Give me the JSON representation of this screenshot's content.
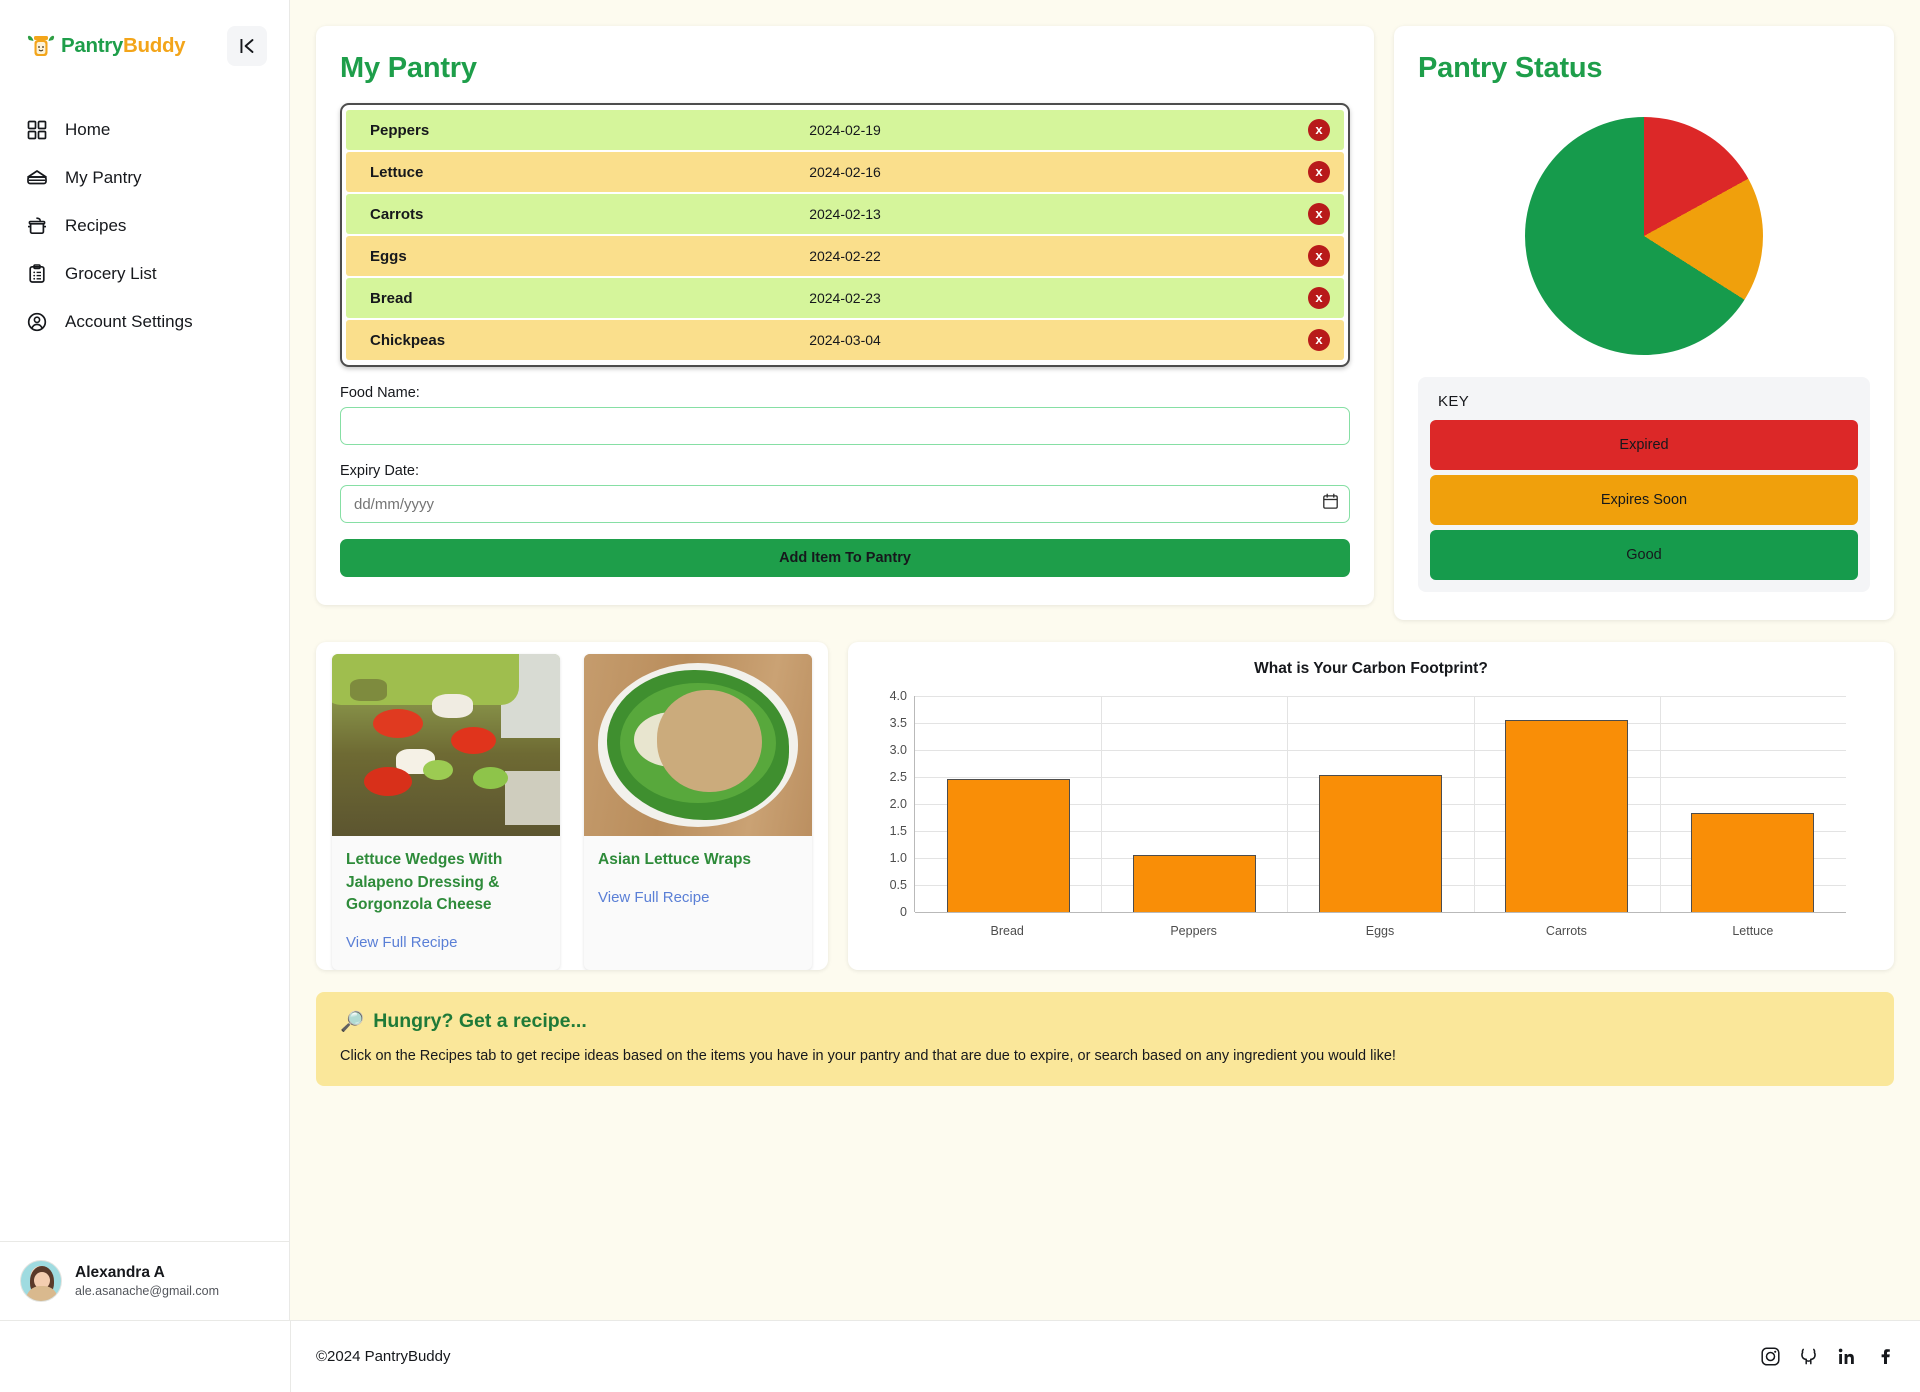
{
  "brand": {
    "name_part1": "Pantry",
    "name_part2": "Buddy",
    "collapse_icon": "collapse-sidebar-icon",
    "collapse_glyph": "I‹"
  },
  "sidebar": {
    "items": [
      {
        "label": "Home",
        "icon": "grid-icon"
      },
      {
        "label": "My Pantry",
        "icon": "pantry-icon"
      },
      {
        "label": "Recipes",
        "icon": "pot-icon"
      },
      {
        "label": "Grocery List",
        "icon": "clipboard-icon"
      },
      {
        "label": "Account Settings",
        "icon": "user-circle-icon"
      }
    ],
    "user": {
      "name": "Alexandra A",
      "email": "ale.asanache@gmail.com"
    }
  },
  "pantry": {
    "title": "My Pantry",
    "items": [
      {
        "name": "Peppers",
        "date": "2024-02-19",
        "status": "good"
      },
      {
        "name": "Lettuce",
        "date": "2024-02-16",
        "status": "soon"
      },
      {
        "name": "Carrots",
        "date": "2024-02-13",
        "status": "good"
      },
      {
        "name": "Eggs",
        "date": "2024-02-22",
        "status": "soon"
      },
      {
        "name": "Bread",
        "date": "2024-02-23",
        "status": "good"
      },
      {
        "name": "Chickpeas",
        "date": "2024-03-04",
        "status": "soon"
      }
    ],
    "delete_glyph": "x",
    "form": {
      "food_label": "Food Name:",
      "food_value": "",
      "food_placeholder": "",
      "expiry_label": "Expiry Date:",
      "expiry_placeholder": "dd/mm/yyyy",
      "expiry_value": "",
      "submit_label": "Add Item To Pantry"
    }
  },
  "status": {
    "title": "Pantry Status",
    "key_title": "KEY",
    "legend": [
      {
        "label": "Expired",
        "color": "#dc2828"
      },
      {
        "label": "Expires Soon",
        "color": "#f0a00c"
      },
      {
        "label": "Good",
        "color": "#169b4c"
      }
    ],
    "chart_data": {
      "type": "pie",
      "title": "Pantry Status",
      "categories": [
        "Expired",
        "Expires Soon",
        "Good"
      ],
      "values": [
        17,
        17,
        66
      ],
      "colors": [
        "#dc2828",
        "#f0a00c",
        "#169b4c"
      ],
      "legend_position": "below"
    }
  },
  "recipes": [
    {
      "title": "Lettuce Wedges With Jalapeno Dressing & Gorgonzola Cheese",
      "link_label": "View Full Recipe",
      "image": "lettuce-wedge-salad-photo"
    },
    {
      "title": "Asian Lettuce Wraps",
      "link_label": "View Full Recipe",
      "image": "asian-lettuce-wrap-photo"
    }
  ],
  "chart_data": {
    "type": "bar",
    "title": "What is Your Carbon Footprint?",
    "categories": [
      "Bread",
      "Peppers",
      "Eggs",
      "Carrots",
      "Lettuce"
    ],
    "values": [
      2.47,
      1.06,
      2.53,
      3.56,
      1.84
    ],
    "xlabel": "",
    "ylabel": "",
    "ylim": [
      0,
      4.0
    ],
    "yticks": [
      "0",
      "0.5",
      "1.0",
      "1.5",
      "2.0",
      "2.5",
      "3.0",
      "3.5",
      "4.0"
    ],
    "bar_color": "#f98e07",
    "grid": true,
    "legend_position": "none"
  },
  "banner": {
    "emoji": "🔎",
    "title": "Hungry? Get a recipe...",
    "text": "Click on the Recipes tab to get recipe ideas based on the items you have in your pantry and that are due to expire, or search based on any ingredient you would like!"
  },
  "footer": {
    "copyright": "©2024 PantryBuddy",
    "socials": [
      "instagram-icon",
      "github-icon",
      "linkedin-icon",
      "facebook-icon"
    ]
  }
}
